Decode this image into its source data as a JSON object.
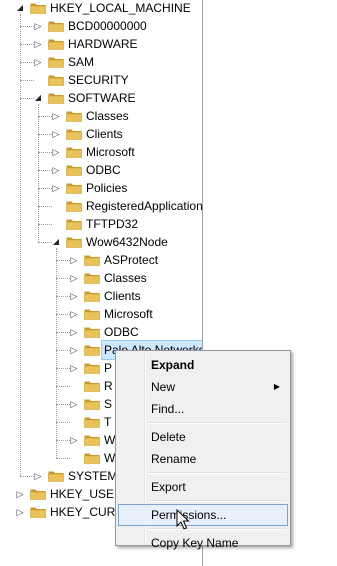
{
  "tree": [
    {
      "id": "hklm",
      "label": "HKEY_LOCAL_MACHINE",
      "level": 0,
      "expander": "expanded"
    },
    {
      "id": "bcd",
      "label": "BCD00000000",
      "level": 1,
      "expander": "collapsed"
    },
    {
      "id": "hardware",
      "label": "HARDWARE",
      "level": 1,
      "expander": "collapsed"
    },
    {
      "id": "sam",
      "label": "SAM",
      "level": 1,
      "expander": "collapsed"
    },
    {
      "id": "security",
      "label": "SECURITY",
      "level": 1,
      "expander": "none"
    },
    {
      "id": "software",
      "label": "SOFTWARE",
      "level": 1,
      "expander": "expanded"
    },
    {
      "id": "classes",
      "label": "Classes",
      "level": 2,
      "expander": "collapsed"
    },
    {
      "id": "clients",
      "label": "Clients",
      "level": 2,
      "expander": "collapsed"
    },
    {
      "id": "microsoft",
      "label": "Microsoft",
      "level": 2,
      "expander": "collapsed"
    },
    {
      "id": "odbc",
      "label": "ODBC",
      "level": 2,
      "expander": "collapsed"
    },
    {
      "id": "policies",
      "label": "Policies",
      "level": 2,
      "expander": "collapsed"
    },
    {
      "id": "registeredapplications",
      "label": "RegisteredApplications",
      "level": 2,
      "expander": "none"
    },
    {
      "id": "tftpd32",
      "label": "TFTPD32",
      "level": 2,
      "expander": "none"
    },
    {
      "id": "wow6432node",
      "label": "Wow6432Node",
      "level": 2,
      "expander": "expanded"
    },
    {
      "id": "asprotect",
      "label": "ASProtect",
      "level": 3,
      "expander": "collapsed"
    },
    {
      "id": "wow-classes",
      "label": "Classes",
      "level": 3,
      "expander": "collapsed"
    },
    {
      "id": "wow-clients",
      "label": "Clients",
      "level": 3,
      "expander": "collapsed"
    },
    {
      "id": "wow-microsoft",
      "label": "Microsoft",
      "level": 3,
      "expander": "collapsed"
    },
    {
      "id": "wow-odbc",
      "label": "ODBC",
      "level": 3,
      "expander": "collapsed"
    },
    {
      "id": "paloalto",
      "label": "Palo Alto Networks",
      "level": 3,
      "expander": "collapsed",
      "selected": true
    },
    {
      "id": "p-item",
      "label": "P",
      "level": 3,
      "expander": "collapsed"
    },
    {
      "id": "r-item",
      "label": "R",
      "level": 3,
      "expander": "none"
    },
    {
      "id": "s-item",
      "label": "S",
      "level": 3,
      "expander": "collapsed"
    },
    {
      "id": "t-item",
      "label": "T",
      "level": 3,
      "expander": "none"
    },
    {
      "id": "w-item1",
      "label": "W",
      "level": 3,
      "expander": "collapsed"
    },
    {
      "id": "w-item2",
      "label": "W",
      "level": 3,
      "expander": "none"
    },
    {
      "id": "system",
      "label": "SYSTEM",
      "level": 1,
      "expander": "collapsed"
    },
    {
      "id": "hku",
      "label": "HKEY_USERS",
      "level": 0,
      "expander": "collapsed"
    },
    {
      "id": "hkcc",
      "label": "HKEY_CURRENT_CONFIG",
      "level": 0,
      "expander": "collapsed"
    }
  ],
  "context_menu": {
    "items": [
      {
        "id": "expand",
        "label": "Expand",
        "bold": true
      },
      {
        "id": "new",
        "label": "New",
        "submenu": true
      },
      {
        "id": "find",
        "label": "Find..."
      },
      {
        "sep": true
      },
      {
        "id": "delete",
        "label": "Delete"
      },
      {
        "id": "rename",
        "label": "Rename"
      },
      {
        "sep": true
      },
      {
        "id": "export",
        "label": "Export"
      },
      {
        "sep": true
      },
      {
        "id": "permissions",
        "label": "Permissions...",
        "hover": true
      },
      {
        "sep": true
      },
      {
        "id": "copy-key-name",
        "label": "Copy Key Name"
      }
    ]
  },
  "icons": {
    "folder": "folder-icon",
    "expanded": "expanded-triangle-icon",
    "collapsed": "collapsed-triangle-icon",
    "submenu": "submenu-arrow-icon",
    "cursor": "mouse-pointer-icon"
  },
  "colors": {
    "folder_fill": "#e9c25a",
    "folder_dark": "#c79a2b",
    "selection": "#cde8ff",
    "menu_bg": "#f0f0f0",
    "menu_hover": "#e8f1fb",
    "menu_hover_border": "#7da2ce"
  }
}
